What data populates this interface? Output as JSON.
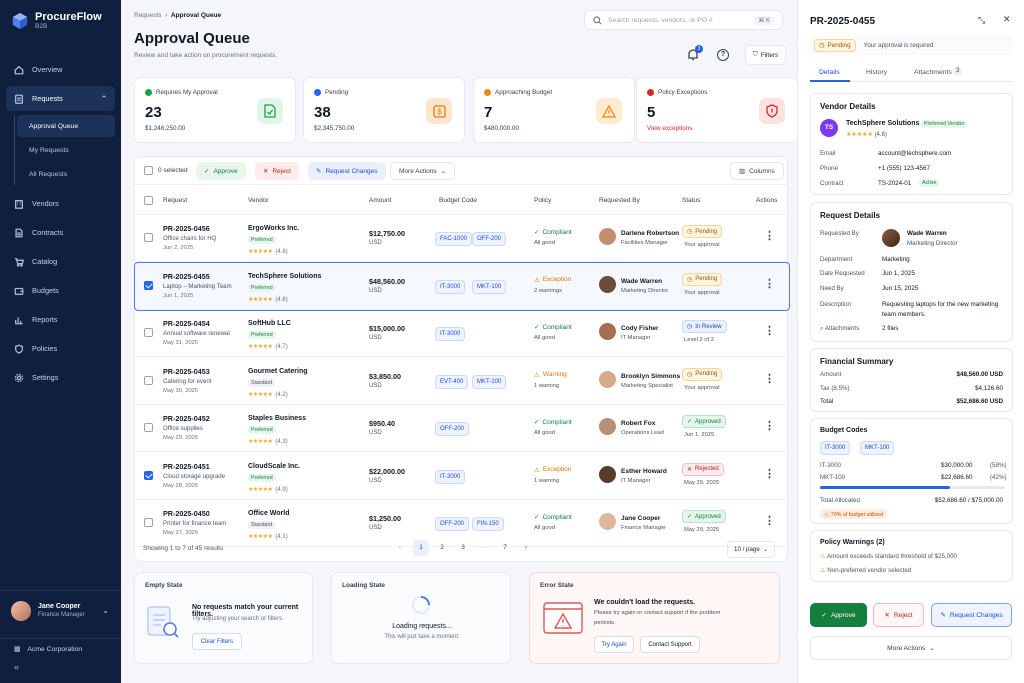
{
  "app": {
    "name": "ProcureFlow",
    "sub": "B2B"
  },
  "nav": {
    "items": [
      {
        "label": "Overview"
      },
      {
        "label": "Requests"
      },
      {
        "label": "Vendors"
      },
      {
        "label": "Contracts"
      },
      {
        "label": "Catalog"
      },
      {
        "label": "Budgets"
      },
      {
        "label": "Reports"
      },
      {
        "label": "Policies"
      },
      {
        "label": "Settings"
      }
    ],
    "sub": [
      "Approval Queue",
      "My Requests",
      "All Requests"
    ]
  },
  "user": {
    "name": "Jane Cooper",
    "role": "Finance Manager"
  },
  "org": "Acme Corporation",
  "header": {
    "crumb1": "Requests",
    "crumb2": "Approval Queue",
    "title": "Approval Queue",
    "subtitle": "Review and take action on procurement requests.",
    "search_placeholder": "Search requests, vendors, or PO #",
    "kbd": "⌘ K",
    "bell_count": "3",
    "filters": "Filters"
  },
  "stats": [
    {
      "label": "Requires My Approval",
      "value": "23",
      "sub": "$1,246,250.00",
      "color": "#16a34a",
      "bg": "#e7f6ec"
    },
    {
      "label": "Pending",
      "value": "38",
      "sub": "$2,345,750.00",
      "color": "#2563eb",
      "bg": "#fde9d7"
    },
    {
      "label": "Approaching Budget",
      "value": "7",
      "sub": "$480,000.00",
      "color": "#ea8a0c",
      "bg": "#fdeed4"
    },
    {
      "label": "Policy Exceptions",
      "value": "5",
      "sub": "View exceptions",
      "color": "#dc2626",
      "bg": "#fde4e4"
    }
  ],
  "toolbar": {
    "selected": "0 selected",
    "approve": "Approve",
    "reject": "Reject",
    "changes": "Request Changes",
    "more": "More Actions",
    "columns": "Columns"
  },
  "columns": [
    "Request",
    "Vendor",
    "Amount",
    "Budget Code",
    "Policy",
    "Requested By",
    "Status",
    "Actions"
  ],
  "rows": [
    {
      "id": "PR-2025-0456",
      "desc": "Office chairs for HQ",
      "date": "Jun 2, 2025",
      "vendor": "ErgoWorks Inc.",
      "tag": "Preferred",
      "rating": "(4.8)",
      "amount": "$12,750.00",
      "cur": "USD",
      "codes": [
        "FAC-1000",
        "OFF-200"
      ],
      "policy": "Compliant",
      "policy_sub": "All good",
      "req": "Darlene Robertson",
      "req_role": "Facilities Manager",
      "status": "Pending",
      "status_sub": "Your approval",
      "checked": false
    },
    {
      "id": "PR-2025-0455",
      "desc": "Laptop – Marketing Team",
      "date": "Jun 1, 2025",
      "vendor": "TechSphere Solutions",
      "tag": "Preferred",
      "rating": "(4.6)",
      "amount": "$48,560.00",
      "cur": "USD",
      "codes": [
        "IT-3000",
        "MKT-100"
      ],
      "policy": "Exception",
      "policy_sub": "2 warnings",
      "req": "Wade Warren",
      "req_role": "Marketing Director",
      "status": "Pending",
      "status_sub": "Your approval",
      "checked": true
    },
    {
      "id": "PR-2025-0454",
      "desc": "Annual software renewal",
      "date": "May 31, 2025",
      "vendor": "SoftHub LLC",
      "tag": "Preferred",
      "rating": "(4.7)",
      "amount": "$15,000.00",
      "cur": "USD",
      "codes": [
        "IT-3000"
      ],
      "policy": "Compliant",
      "policy_sub": "All good",
      "req": "Cody Fisher",
      "req_role": "IT Manager",
      "status": "In Review",
      "status_sub": "Level 2 of 2",
      "checked": false
    },
    {
      "id": "PR-2025-0453",
      "desc": "Catering for event",
      "date": "May 30, 2025",
      "vendor": "Gourmet Catering",
      "tag": "Standard",
      "rating": "(4.2)",
      "amount": "$3,850.00",
      "cur": "USD",
      "codes": [
        "EVT-400",
        "MKT-100"
      ],
      "policy": "Warning",
      "policy_sub": "1 warning",
      "req": "Brooklyn Simmons",
      "req_role": "Marketing Specialist",
      "status": "Pending",
      "status_sub": "Your approval",
      "checked": false
    },
    {
      "id": "PR-2025-0452",
      "desc": "Office supplies",
      "date": "May 29, 2025",
      "vendor": "Staples Business",
      "tag": "Preferred",
      "rating": "(4.3)",
      "amount": "$950.40",
      "cur": "USD",
      "codes": [
        "OFF-200"
      ],
      "policy": "Compliant",
      "policy_sub": "All good",
      "req": "Robert Fox",
      "req_role": "Operations Lead",
      "status": "Approved",
      "status_sub": "Jun 1, 2025",
      "checked": false
    },
    {
      "id": "PR-2025-0451",
      "desc": "Cloud storage upgrade",
      "date": "May 28, 2025",
      "vendor": "CloudScale Inc.",
      "tag": "Preferred",
      "rating": "(4.9)",
      "amount": "$22,000.00",
      "cur": "USD",
      "codes": [
        "IT-3000"
      ],
      "policy": "Exception",
      "policy_sub": "1 warning",
      "req": "Esther Howard",
      "req_role": "IT Manager",
      "status": "Rejected",
      "status_sub": "May 29, 2025",
      "checked": true
    },
    {
      "id": "PR-2025-0450",
      "desc": "Printer for finance team",
      "date": "May 27, 2025",
      "vendor": "Office World",
      "tag": "Standard",
      "rating": "(4.1)",
      "amount": "$1,250.00",
      "cur": "USD",
      "codes": [
        "OFF-200",
        "FIN-150"
      ],
      "policy": "Compliant",
      "policy_sub": "All good",
      "req": "Jane Cooper",
      "req_role": "Finance Manager",
      "status": "Approved",
      "status_sub": "May 29, 2025",
      "checked": false
    }
  ],
  "pagination": {
    "showing": "Showing 1 to 7 of 45 results",
    "pages": [
      "1",
      "2",
      "3",
      "···",
      "7"
    ],
    "per_page": "10 / page"
  },
  "empty": {
    "h": "Empty State",
    "title": "No requests match your current filters.",
    "body": "Try adjusting your search or filters.",
    "btn": "Clear Filters"
  },
  "loading": {
    "h": "Loading State",
    "title": "Loading requests...",
    "body": "This will just take a moment."
  },
  "error": {
    "h": "Error State",
    "title": "We couldn't load the requests.",
    "body1": "Please try again or contact support if the problem",
    "body2": "persists.",
    "btn1": "Try Again",
    "btn2": "Contact Support"
  },
  "panel": {
    "title": "PR-2025-0455",
    "pending": "Pending",
    "pending_note": "Your approval is required",
    "tabs": [
      "Details",
      "History",
      "Attachments"
    ],
    "attach_count": "3",
    "vendor": {
      "h": "Vendor Details",
      "initials": "TS",
      "name": "TechSphere Solutions",
      "tag": "Preferred Vendor",
      "rating": "(4.6)",
      "email_l": "Email",
      "email": "account@techsphere.com",
      "phone_l": "Phone",
      "phone": "+1 (555) 123-4567",
      "contract_l": "Contract",
      "contract": "TS-2024-01",
      "contract_tag": "Active"
    },
    "request": {
      "h": "Request Details",
      "by_l": "Requested By",
      "by": "Wade Warren",
      "by_role": "Marketing Director",
      "dept_l": "Department",
      "dept": "Marketing",
      "date_l": "Date Requested",
      "date": "Jun 1, 2025",
      "need_l": "Need By",
      "need": "Jun 15, 2025",
      "desc_l": "Description",
      "desc1": "Requesting laptops for the new marketing",
      "desc2": "team members.",
      "att_l": "Attachments",
      "att": "2 files"
    },
    "financial": {
      "h": "Financial Summary",
      "amount_l": "Amount",
      "amount": "$48,560.00 USD",
      "tax_l": "Tax (8.5%)",
      "tax": "$4,126.60",
      "total_l": "Total",
      "total": "$52,686.60 USD"
    },
    "budget": {
      "h": "Budget Codes",
      "codes": [
        "IT-3000",
        "MKT-100"
      ],
      "l1": "IT-3000",
      "v1": "$30,000.00",
      "p1": "(58%)",
      "l2": "MKT-100",
      "v2": "$22,686.60",
      "p2": "(42%)",
      "alloc_l": "Total Allocated",
      "alloc": "$52,686.60 / $75,000.00",
      "util": "70% of budget utilized",
      "util_pct": 70
    },
    "warnings": {
      "h": "Policy Warnings (2)",
      "w1": "Amount exceeds standard threshold of $25,000",
      "w2": "Non-preferred vendor selected"
    },
    "actions": {
      "approve": "Approve",
      "reject": "Reject",
      "changes": "Request Changes",
      "more": "More Actions"
    }
  }
}
